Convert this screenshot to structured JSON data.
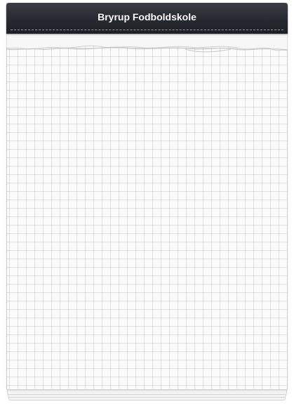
{
  "header": {
    "title": "Bryrup Fodboldskole"
  },
  "colors": {
    "binding": "#272a31",
    "paper": "#fbfbfb",
    "grid_line": "#d6d6da",
    "title_text": "#ffffff"
  }
}
